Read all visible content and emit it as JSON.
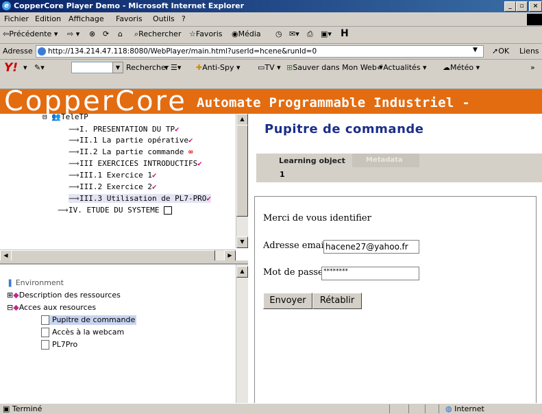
{
  "window": {
    "title": "CopperCore Player Demo - Microsoft Internet Explorer"
  },
  "menu": {
    "items": [
      "Fichier",
      "Edition",
      "Affichage",
      "Favoris",
      "Outils",
      "?"
    ]
  },
  "toolbar": {
    "back": "Précédente",
    "search": "Rechercher",
    "favorites": "Favoris",
    "media": "Média"
  },
  "address": {
    "label": "Adresse",
    "url": "http://134.214.47.118:8080/WebPlayer/main.html?userId=hcene&runId=0",
    "go": "OK",
    "links": "Liens"
  },
  "yahoo": {
    "search": "Rechercher",
    "antispy": "Anti-Spy",
    "tv": "TV",
    "save": "Sauver dans Mon Web",
    "news": "Actualités",
    "weather": "Météo"
  },
  "banner": {
    "logo": "CopperCore",
    "title": "Automate Programmable Industriel -"
  },
  "tree": {
    "root": "TeleTP",
    "items": [
      {
        "label": "I. PRESENTATION DU TP",
        "status": "check"
      },
      {
        "label": "II.1 La partie opérative",
        "status": "check"
      },
      {
        "label": "II.2 La partie commande",
        "status": "infinity"
      },
      {
        "label": "III EXERCICES INTRODUCTIFS",
        "status": "check"
      },
      {
        "label": "III.1 Exercice 1",
        "status": "check"
      },
      {
        "label": "III.2 Exercice 2",
        "status": "check"
      },
      {
        "label": "III.3 Utilisation de PL7-PRO",
        "status": "check",
        "selected": true
      },
      {
        "label": "IV. ETUDE DU SYSTEME",
        "status": "box"
      }
    ]
  },
  "environment": {
    "root": "Environment",
    "groups": [
      {
        "label": "Description des ressources",
        "expanded": false
      },
      {
        "label": "Acces aux resources",
        "expanded": true
      }
    ],
    "items": [
      {
        "label": "Pupitre de commande",
        "selected": true
      },
      {
        "label": "Accès à la webcam"
      },
      {
        "label": "PL7Pro"
      }
    ]
  },
  "content": {
    "title": "Pupitre de commande",
    "tabs": [
      "Learning object",
      "Metadata"
    ],
    "page_number": "1",
    "form": {
      "intro": "Merci de vous identifier",
      "email_label": "Adresse email",
      "email_value": "hacene27@yahoo.fr",
      "password_label": "Mot de passe",
      "password_value": "********",
      "submit": "Envoyer",
      "reset": "Rétablir"
    }
  },
  "status": {
    "left": "Terminé",
    "zone": "Internet"
  },
  "colors": {
    "banner": "#e36c10",
    "title_blue": "#1b2e8a",
    "check": "#c2187a"
  }
}
